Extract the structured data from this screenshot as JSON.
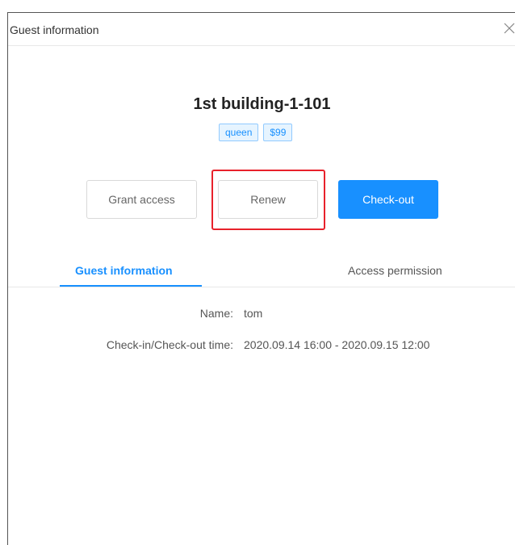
{
  "dialog": {
    "title": "Guest information",
    "close_glyph": "×"
  },
  "room": {
    "name": "1st building-1-101",
    "tags": [
      "queen",
      "$99"
    ]
  },
  "actions": {
    "grant_access": "Grant access",
    "renew": "Renew",
    "check_out": "Check-out"
  },
  "tabs": {
    "guest_information": "Guest information",
    "access_permission": "Access permission",
    "active": "guest_information"
  },
  "guest": {
    "name_label": "Name:",
    "name_value": "tom",
    "time_label": "Check-in/Check-out time:",
    "time_value": "2020.09.14 16:00 - 2020.09.15 12:00"
  },
  "colors": {
    "accent": "#1890ff",
    "highlight": "#e8212b"
  },
  "icons": {
    "close": "close-icon"
  }
}
